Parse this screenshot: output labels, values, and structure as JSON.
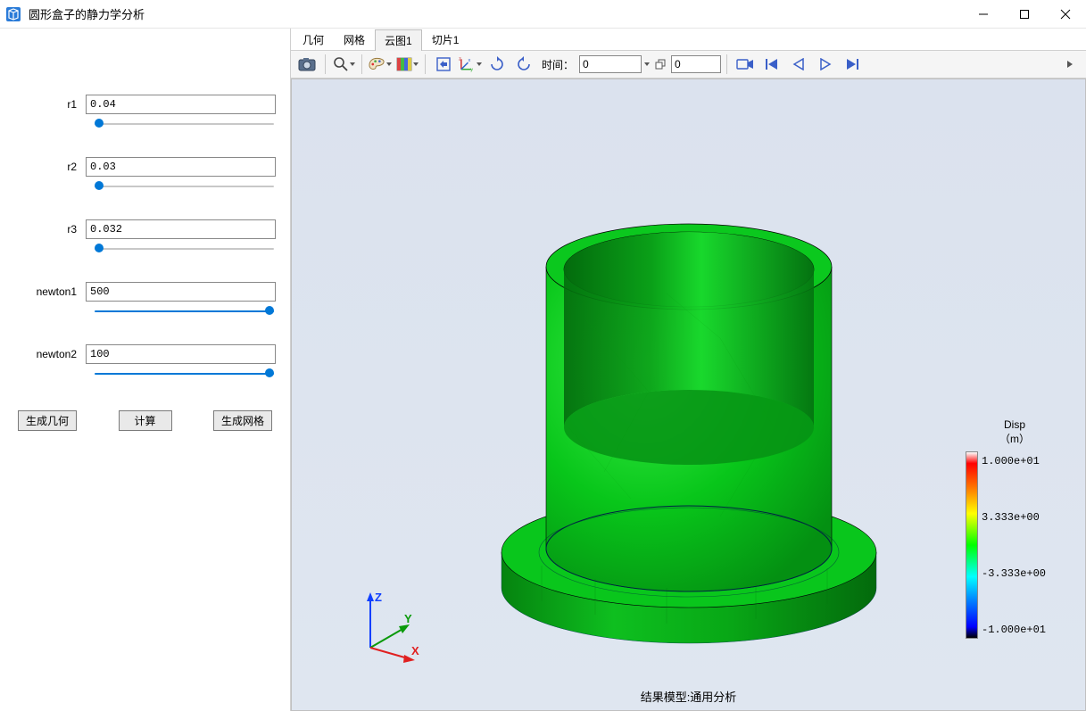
{
  "window": {
    "title": "圆形盒子的静力学分析"
  },
  "sidebar": {
    "params": [
      {
        "label": "r1",
        "value": "0.04"
      },
      {
        "label": "r2",
        "value": "0.03"
      },
      {
        "label": "r3",
        "value": "0.032"
      },
      {
        "label": "newton1",
        "value": "500"
      },
      {
        "label": "newton2",
        "value": "100"
      }
    ],
    "buttons": {
      "gen_geom": "生成几何",
      "compute": "计算",
      "gen_mesh": "生成网格"
    }
  },
  "tabs": [
    "几何",
    "网格",
    "云图1",
    "切片1"
  ],
  "active_tab_index": 2,
  "toolbar": {
    "time_label": "时间：",
    "time_value": "0",
    "time_secondary": "0"
  },
  "viewport": {
    "caption": "结果模型:通用分析",
    "axes": {
      "x": "X",
      "y": "Y",
      "z": "Z"
    }
  },
  "legend": {
    "title": "Disp",
    "unit": "（m）",
    "ticks": [
      {
        "pos": 0.05,
        "label": "1.000e+01"
      },
      {
        "pos": 0.35,
        "label": "3.333e+00"
      },
      {
        "pos": 0.65,
        "label": "-3.333e+00"
      },
      {
        "pos": 0.95,
        "label": "-1.000e+01"
      }
    ]
  }
}
